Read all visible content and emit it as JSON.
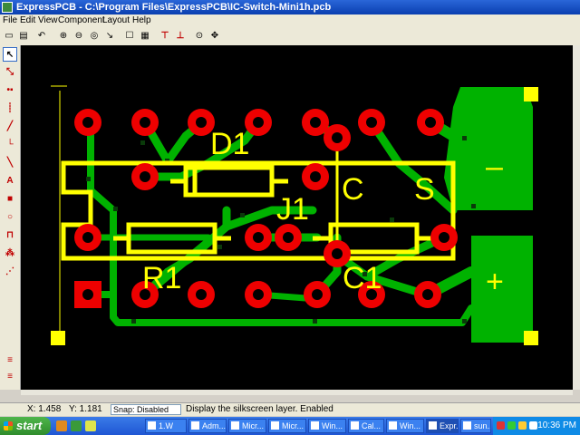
{
  "window": {
    "title": "ExpressPCB - C:\\Program Files\\ExpressPCB\\IC-Switch-Mini1h.pcb"
  },
  "menu": [
    "File",
    "Edit",
    "View",
    "Component",
    "Layout",
    "Help"
  ],
  "toolbar_icons": [
    "new-icon",
    "open-icon",
    "save-icon",
    "undo-icon",
    "zoom-in-icon",
    "zoom-out-icon",
    "zoom-fit-icon",
    "zoom-window-icon",
    "select-icon",
    "properties-icon",
    "components-icon",
    "layers-icon",
    "measure-icon"
  ],
  "canvas": {
    "labels": {
      "d1": "D1",
      "j1": "J1",
      "r1": "R1",
      "c1": "C1",
      "c": "C",
      "s": "S",
      "minus": "–",
      "plus": "+"
    }
  },
  "colors": {
    "pcb_background": "#000000",
    "copper": "#00b200",
    "silkscreen": "#ffff00",
    "pad": "#ee0000",
    "hole": "#000000"
  },
  "status": {
    "x": "X: 1.458",
    "y": "Y: 1.181",
    "snap": "Snap: Disabled",
    "message": "Display the silkscreen layer. Enabled"
  },
  "taskbar": {
    "start": "start",
    "tasks": [
      "1.W",
      "Adm...",
      "Micr...",
      "Micr...",
      "Win...",
      "Cal...",
      "Win...",
      "Expr...",
      "sun..."
    ],
    "clock": "10:36 PM"
  }
}
